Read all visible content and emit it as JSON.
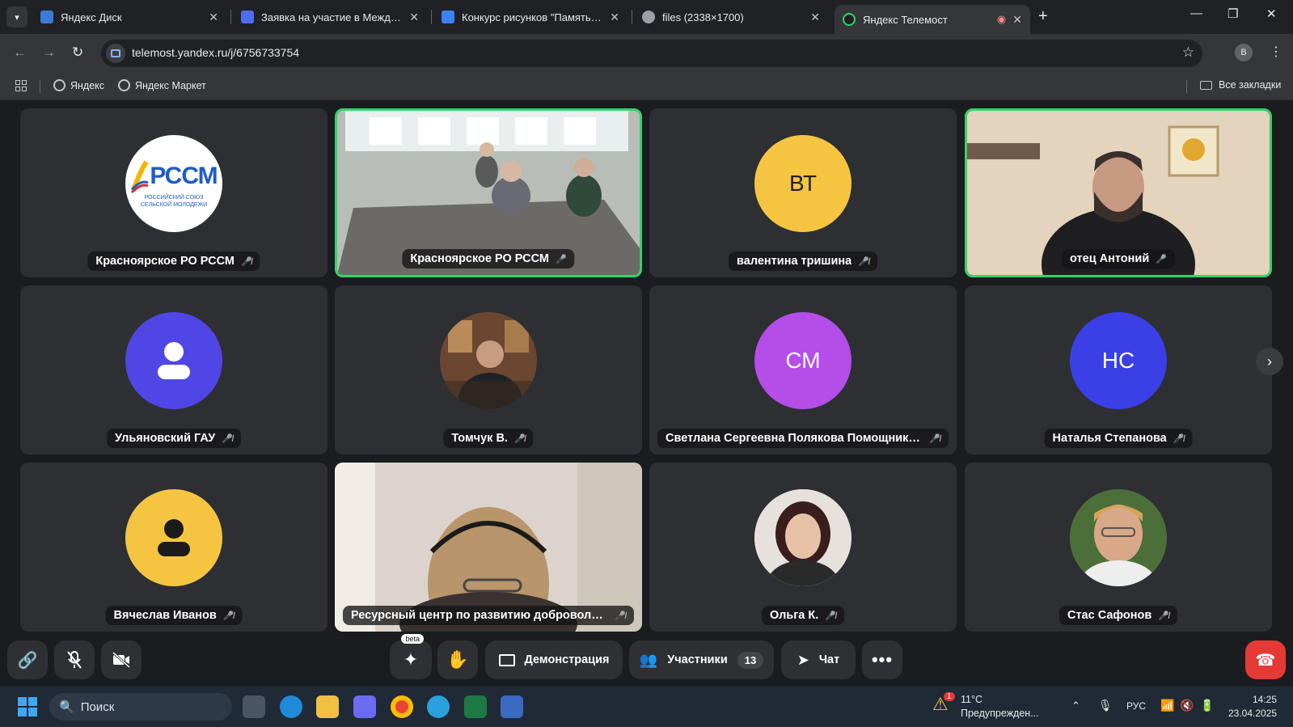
{
  "browser": {
    "tabs": [
      {
        "title": "Яндекс Диск",
        "color": "#3a7bd5"
      },
      {
        "title": "Заявка на участие в Междунар",
        "color": "#4f6bf0"
      },
      {
        "title": "Конкурс рисунков \"Память в с",
        "color": "#3b82f6"
      },
      {
        "title": "files (2338×1700)",
        "color": "#9aa0a6"
      },
      {
        "title": "Яндекс Телемост",
        "color": "#35d26a"
      }
    ],
    "url": "telemost.yandex.ru/j/6756733754",
    "profile_initial": "B",
    "bookmarks": [
      "Яндекс",
      "Яндекс Маркет"
    ],
    "all_bookmarks": "Все закладки"
  },
  "participants": [
    {
      "name": "Красноярское РО РССМ",
      "kind": "logo",
      "logo_text": "РССМ",
      "logo_sub": "РОССИЙСКИЙ СОЮЗ СЕЛЬСКОЙ МОЛОДЕЖИ",
      "muted": true
    },
    {
      "name": "Красноярское РО РССМ",
      "kind": "video",
      "muted": false,
      "speaking": true
    },
    {
      "name": "валентина тришина",
      "kind": "initials",
      "initials": "ВТ",
      "color": "#f5c542",
      "text_color": "#222222",
      "muted": true
    },
    {
      "name": "отец Антоний",
      "kind": "video",
      "muted": false,
      "speaking": true
    },
    {
      "name": "Ульяновский ГАУ",
      "kind": "placeholder",
      "color": "#4f46e5",
      "muted": true
    },
    {
      "name": "Томчук В.",
      "kind": "photo",
      "muted": true
    },
    {
      "name": "Светлана Сергеевна Полякова Помощник про...",
      "kind": "initials",
      "initials": "СМ",
      "color": "#b54de8",
      "text_color": "#ffffff",
      "muted": true
    },
    {
      "name": "Наталья Степанова",
      "kind": "initials",
      "initials": "НС",
      "color": "#3b3fe6",
      "text_color": "#ffffff",
      "muted": true
    },
    {
      "name": "Вячеслав Иванов",
      "kind": "placeholder",
      "color": "#f5c542",
      "muted": true
    },
    {
      "name": "Ресурсный центр по развитию добровольчес...",
      "kind": "video",
      "muted": true
    },
    {
      "name": "Ольга К.",
      "kind": "photo",
      "muted": true
    },
    {
      "name": "Стас Сафонов",
      "kind": "photo",
      "muted": true
    }
  ],
  "controls": {
    "beta_label": "beta",
    "demo_label": "Демонстрация",
    "participants_label": "Участники",
    "participants_count": "13",
    "chat_label": "Чат"
  },
  "taskbar": {
    "search_placeholder": "Поиск",
    "weather_temp": "11°C",
    "weather_text": "Предупрежден...",
    "weather_badge": "1",
    "lang": "РУС",
    "time": "14:25",
    "date": "23.04.2025"
  }
}
